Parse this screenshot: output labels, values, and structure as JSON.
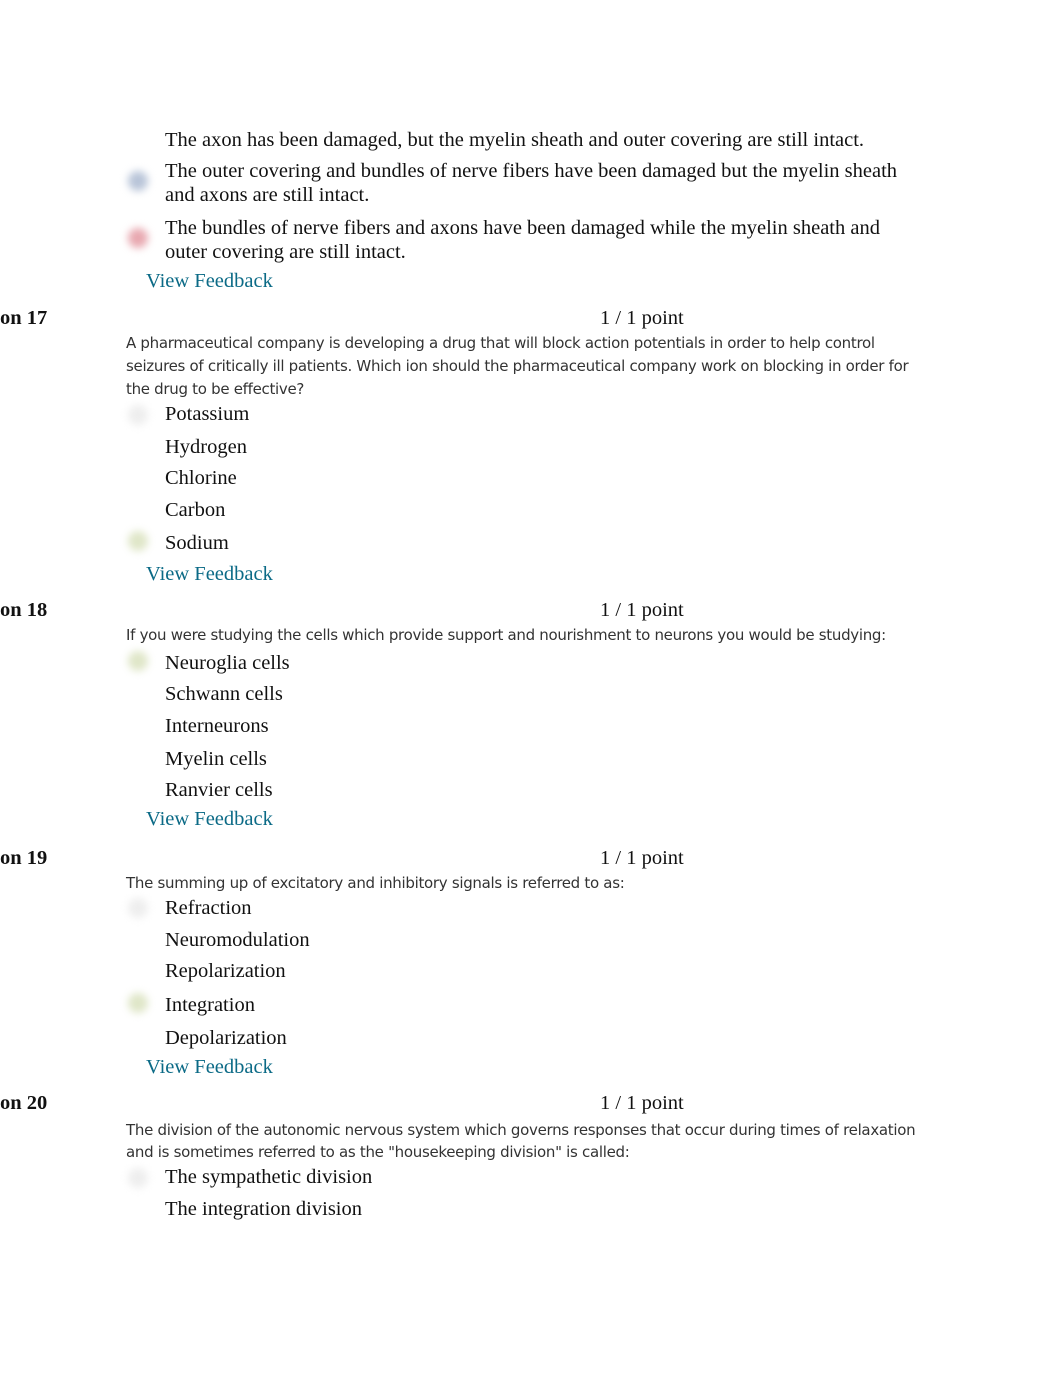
{
  "q16": {
    "options": [
      "The axon has been damaged, but the myelin sheath and outer covering are still intact.",
      "The outer covering and bundles of nerve fibers have been damaged but the myelin sheath and axons are still intact.",
      "The bundles of nerve fibers and axons have been damaged while the myelin sheath and outer covering are still intact."
    ],
    "feedback": "View Feedback"
  },
  "q17": {
    "label": "on 17",
    "points": "1 / 1 point",
    "prompt": "A pharmaceutical company is developing a drug that will block action potentials in order to help control seizures of critically ill patients. Which ion should the pharmaceutical company work on blocking in order for the drug to be effective?",
    "options": [
      "Potassium",
      "Hydrogen",
      "Chlorine",
      "Carbon",
      "Sodium"
    ],
    "feedback": "View Feedback"
  },
  "q18": {
    "label": "on 18",
    "points": "1 / 1 point",
    "prompt": "If you were studying the cells which provide support and nourishment to neurons you would be studying:",
    "options": [
      "Neuroglia cells",
      "Schwann cells",
      "Interneurons",
      "Myelin cells",
      "Ranvier cells"
    ],
    "feedback": "View Feedback"
  },
  "q19": {
    "label": "on 19",
    "points": "1 / 1 point",
    "prompt": "The summing up of excitatory and inhibitory signals is referred to as:",
    "options": [
      "Refraction",
      "Neuromodulation",
      "Repolarization",
      "Integration",
      "Depolarization"
    ],
    "feedback": "View Feedback"
  },
  "q20": {
    "label": "on 20",
    "points": "1 / 1 point",
    "prompt": "The division of the autonomic nervous system which governs responses that occur during times of relaxation and is sometimes referred to as the \"housekeeping division\" is called:",
    "options": [
      "The sympathetic division",
      "The integration division"
    ]
  },
  "colors": {
    "link": "#0b6a86",
    "selected_mark": "#b8c4d8",
    "incorrect_mark": "#e8a8b0",
    "correct_mark": "#dfe6c8"
  }
}
